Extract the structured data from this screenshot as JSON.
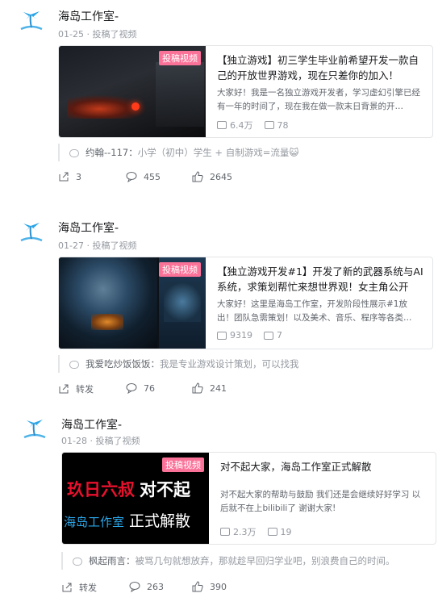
{
  "posts": [
    {
      "author": "海岛工作室-",
      "meta": "01-25 · 投稿了视频",
      "badge": "投稿视频",
      "title": "【独立游戏】初三学生毕业前希望开发一款自己的开放世界游戏，现在只差你的加入！",
      "desc": "大家好！我是一名独立游戏开发者，学习虚幻引擎已经有一年的时间了，现在我在做一款末日背景的开…",
      "views": "6.4万",
      "danmaku": "78",
      "comment_user": "约翰--117：",
      "comment_text": "小学（初中）学生 + 自制游戏=流量😺",
      "share": "3",
      "comments": "455",
      "likes": "2645"
    },
    {
      "author": "海岛工作室-",
      "meta": "01-27 · 投稿了视频",
      "badge": "投稿视频",
      "title": "【独立游戏开发#1】开发了新的武器系统与AI系统，求策划帮忙来想世界观！女主角公开",
      "desc": "大家好！这里是海岛工作室，开发阶段性展示#1放出！团队急需策划！以及美术、音乐、程序等各类…",
      "views": "9319",
      "danmaku": "7",
      "comment_user": "我爱吃炒饭饭饭：",
      "comment_text": "我是专业游戏设计策划，可以找我",
      "share": "转发",
      "comments": "76",
      "likes": "241"
    },
    {
      "author": "海岛工作室-",
      "meta": "01-28 · 投稿了视频",
      "badge": "投稿视频",
      "title": "对不起大家，海岛工作室正式解散",
      "desc": "对不起大家的帮助与鼓励 我们还是会继续好好学习 以后就不在上bilibili了 谢谢大家!",
      "views": "2.3万",
      "danmaku": "19",
      "thumb_line1a": "玖日六叔",
      "thumb_line1b": "对不起",
      "thumb_line2a": "海岛工作室",
      "thumb_line2b": "正式解散",
      "comment_user": "枫起雨言：",
      "comment_text": "被骂几句就想放弃，那就趁早回归学业吧，别浪费自己的时间。",
      "share": "转发",
      "comments": "263",
      "likes": "390"
    }
  ],
  "colors": {
    "badge": "#fb7299",
    "accent_red": "#e8112d",
    "accent_blue": "#2aa6e8"
  }
}
